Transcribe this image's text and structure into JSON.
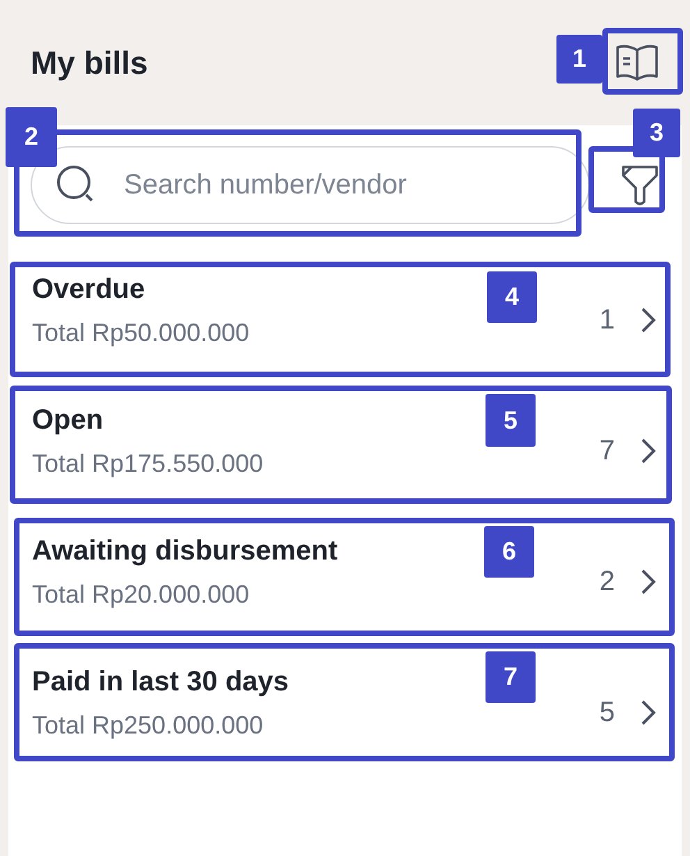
{
  "header": {
    "title": "My bills"
  },
  "search": {
    "placeholder": "Search number/vendor"
  },
  "categories": [
    {
      "title": "Overdue",
      "total": "Total Rp50.000.000",
      "count": "1"
    },
    {
      "title": "Open",
      "total": "Total Rp175.550.000",
      "count": "7"
    },
    {
      "title": "Awaiting disbursement",
      "total": "Total Rp20.000.000",
      "count": "2"
    },
    {
      "title": "Paid in last 30 days",
      "total": "Total Rp250.000.000",
      "count": "5"
    }
  ],
  "annotations": [
    {
      "label": "1"
    },
    {
      "label": "2"
    },
    {
      "label": "3"
    },
    {
      "label": "4"
    },
    {
      "label": "5"
    },
    {
      "label": "6"
    },
    {
      "label": "7"
    }
  ]
}
